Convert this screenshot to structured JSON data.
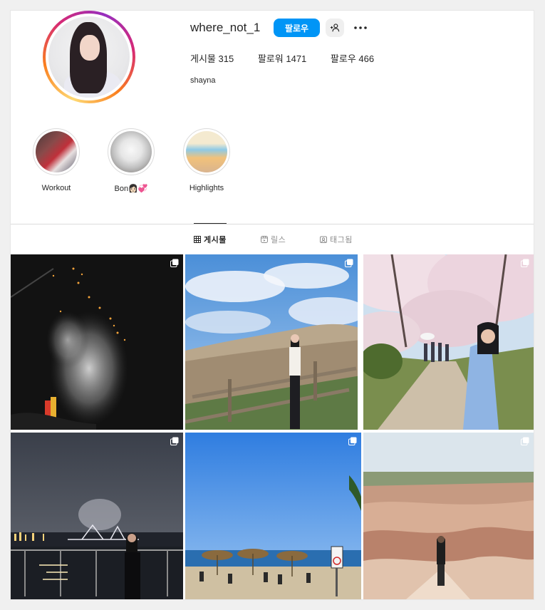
{
  "profile": {
    "username": "where_not_1",
    "follow_label": "팔로우",
    "full_name": "shayna",
    "stats": [
      {
        "label": "게시물",
        "value": "315"
      },
      {
        "label": "팔로워",
        "value": "1471"
      },
      {
        "label": "팔로우",
        "value": "466"
      }
    ]
  },
  "highlights": [
    {
      "label": "Workout"
    },
    {
      "label": "Bon👩🏻💞"
    },
    {
      "label": "Highlights"
    }
  ],
  "tabs": [
    {
      "label": "게시물",
      "icon": "grid-icon",
      "active": true
    },
    {
      "label": "릴스",
      "icon": "reels-icon",
      "active": false
    },
    {
      "label": "태그됨",
      "icon": "tagged-icon",
      "active": false
    }
  ],
  "posts": [
    {
      "scene": "night-fireworks",
      "multi": true
    },
    {
      "scene": "silver-grass-field",
      "multi": true
    },
    {
      "scene": "cherry-blossom-path",
      "multi": true
    },
    {
      "scene": "night-bay-bridge",
      "multi": true
    },
    {
      "scene": "beach-parasols",
      "multi": true
    },
    {
      "scene": "desert-canyon",
      "multi": true
    }
  ],
  "colors": {
    "accent": "#0095f6",
    "text": "#262626",
    "muted": "#8e8e8e",
    "border": "#dbdbdb"
  }
}
